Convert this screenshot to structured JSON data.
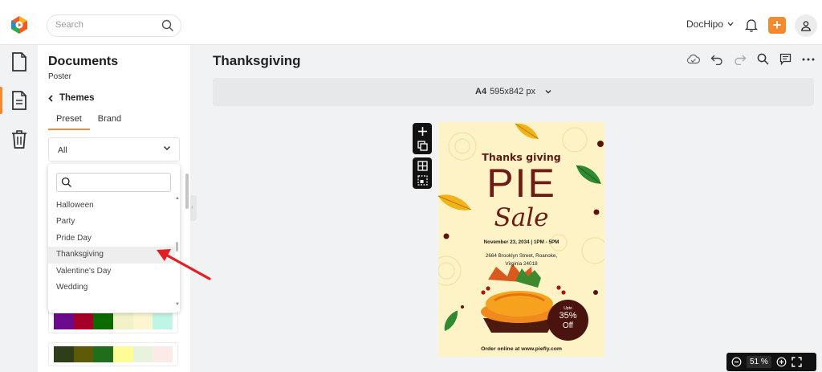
{
  "topbar": {
    "search_placeholder": "Search",
    "account_label": "DocHipo",
    "add_label": "+"
  },
  "rail": {
    "items": [
      {
        "icon": "document-icon",
        "active": false
      },
      {
        "icon": "template-icon",
        "active": true
      },
      {
        "icon": "trash-icon",
        "active": false
      }
    ]
  },
  "panel": {
    "title": "Documents",
    "subtitle": "Poster",
    "back_label": "Themes",
    "tabs": [
      {
        "label": "Preset"
      },
      {
        "label": "Brand"
      }
    ],
    "filter_value": "All",
    "menu_items": [
      "Halloween",
      "Party",
      "Pride Day",
      "Thanksgiving",
      "Valentine's Day",
      "Wedding"
    ],
    "highlighted_item": "Thanksgiving",
    "palettes": [
      [
        "#6b0a8c",
        "#a5002a",
        "#0b6a00",
        "#f1f2c8",
        "#fcf6cf",
        "#bff5e6"
      ],
      [
        "#2d3f19",
        "#5f5a08",
        "#1f6e1c",
        "#fffb96",
        "#e8f3dd",
        "#fbeae6"
      ]
    ]
  },
  "document": {
    "title": "Thanksgiving",
    "size_name": "A4",
    "size_dims": "595x842 px"
  },
  "poster": {
    "line1": "Thanks giving",
    "line2": "PIE",
    "line3": "Sale",
    "date": "November 23, 2034 | 1PM - 5PM",
    "address1": "2664 Brooklyn Street, Roanoke,",
    "address2": "Virginia 24018",
    "badge_top": "Upto",
    "badge_pct": "35%",
    "badge_off": "Off",
    "footer": "Order online at www.piefly.com"
  },
  "zoom": {
    "value": "51",
    "unit": "%"
  },
  "colors": {
    "accent": "#f38a2f",
    "poster_bg": "#fdf3c6",
    "poster_text": "#6d1b15"
  }
}
